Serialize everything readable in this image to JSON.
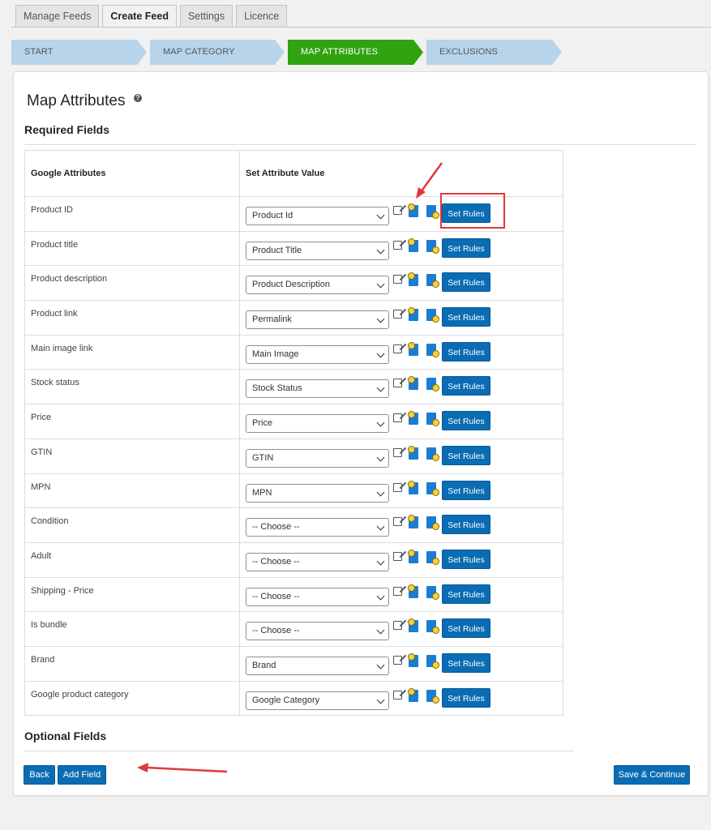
{
  "tabs": [
    {
      "label": "Manage Feeds",
      "active": false
    },
    {
      "label": "Create Feed",
      "active": true
    },
    {
      "label": "Settings",
      "active": false
    },
    {
      "label": "Licence",
      "active": false
    }
  ],
  "steps": [
    {
      "label": "START",
      "active": false
    },
    {
      "label": "MAP CATEGORY",
      "active": false
    },
    {
      "label": "MAP ATTRIBUTES",
      "active": true
    },
    {
      "label": "EXCLUSIONS",
      "active": false
    }
  ],
  "page": {
    "title": "Map Attributes",
    "help_icon": "question-circle-icon",
    "required_section": "Required Fields",
    "optional_section": "Optional Fields"
  },
  "table": {
    "headers": [
      "Google Attributes",
      "Set Attribute Value"
    ],
    "rules_label": "Set Rules",
    "rows": [
      {
        "name": "Product ID",
        "value": "Product Id"
      },
      {
        "name": "Product title",
        "value": "Product Title"
      },
      {
        "name": "Product description",
        "value": "Product Description"
      },
      {
        "name": "Product link",
        "value": "Permalink"
      },
      {
        "name": "Main image link",
        "value": "Main Image"
      },
      {
        "name": "Stock status",
        "value": "Stock Status"
      },
      {
        "name": "Price",
        "value": "Price"
      },
      {
        "name": "GTIN",
        "value": "GTIN"
      },
      {
        "name": "MPN",
        "value": "MPN"
      },
      {
        "name": "Condition",
        "value": "-- Choose --"
      },
      {
        "name": "Adult",
        "value": "-- Choose --"
      },
      {
        "name": "Shipping - Price",
        "value": "-- Choose --"
      },
      {
        "name": "Is bundle",
        "value": "-- Choose --"
      },
      {
        "name": "Brand",
        "value": "Brand"
      },
      {
        "name": "Google product category",
        "value": "Google Category"
      }
    ]
  },
  "buttons": {
    "back": "Back",
    "add_field": "Add Field",
    "save_continue": "Save & Continue"
  },
  "colors": {
    "primary": "#0a6cb3",
    "step_active": "#31a30f",
    "step_inactive": "#b7d4ea",
    "annotation": "#e0393a"
  }
}
